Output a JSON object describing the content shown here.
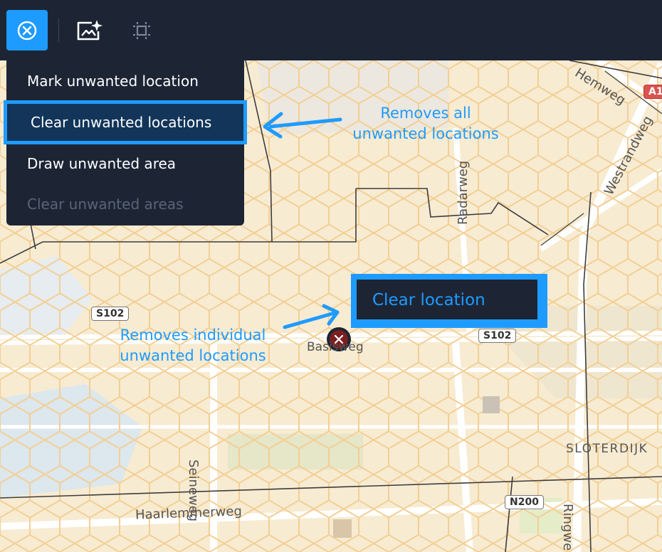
{
  "toolbar": {
    "buttons": [
      {
        "icon": "close-circle-icon",
        "active": true
      },
      {
        "icon": "magic-image-icon",
        "active": false
      },
      {
        "icon": "select-area-icon",
        "active": false
      }
    ]
  },
  "menu": {
    "items": [
      {
        "label": "Mark unwanted location",
        "state": "normal"
      },
      {
        "label": "Clear unwanted locations",
        "state": "highlighted"
      },
      {
        "label": "Draw unwanted area",
        "state": "normal"
      },
      {
        "label": "Clear unwanted areas",
        "state": "disabled"
      }
    ]
  },
  "annotations": {
    "removes_all_line1": "Removes all",
    "removes_all_line2": "unwanted locations",
    "removes_individual_line1": "Removes individual",
    "removes_individual_line2": "unwanted locations"
  },
  "popup": {
    "clear_location_label": "Clear location"
  },
  "map": {
    "streets": {
      "hemweg": "Hemweg",
      "westrandweg": "Westrandweg",
      "radarweg": "Radarweg",
      "basisweg": "Basisweg",
      "seineweg": "Seineweg",
      "haarlemmerweg": "Haarlemmerweg",
      "ringweg": "Ringwe",
      "sloterdijk": "SLOTERDIJK"
    },
    "shields": {
      "s102_left": "S102",
      "s102_right": "S102",
      "n200": "N200",
      "a10": "A1"
    }
  },
  "colors": {
    "accent": "#1e9bff",
    "toolbar_bg": "#1d2535",
    "map_bg": "#f7ebd2",
    "marker": "#7a2020"
  }
}
